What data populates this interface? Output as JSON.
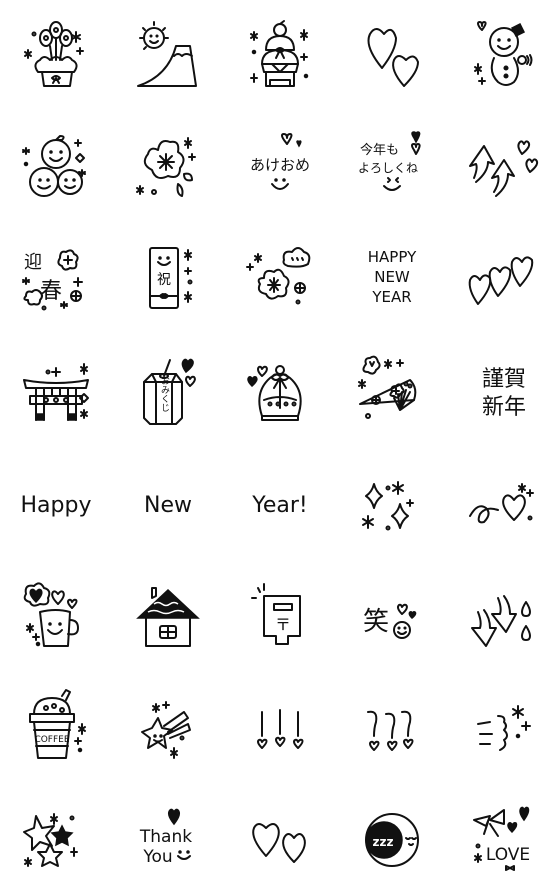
{
  "sticker_set": {
    "layout": {
      "columns": 5,
      "rows": 8
    },
    "stickers": [
      {
        "id": 1,
        "name": "kadomatsu",
        "text": ""
      },
      {
        "id": 2,
        "name": "mount-fuji-sun",
        "text": ""
      },
      {
        "id": 3,
        "name": "kagami-mochi",
        "text": ""
      },
      {
        "id": 4,
        "name": "two-hearts",
        "text": ""
      },
      {
        "id": 5,
        "name": "snowman",
        "text": ""
      },
      {
        "id": 6,
        "name": "mikan-smiles",
        "text": ""
      },
      {
        "id": 7,
        "name": "plum-blossom",
        "text": ""
      },
      {
        "id": 8,
        "name": "akeome",
        "text": "あけおめ"
      },
      {
        "id": 9,
        "name": "kotoshi-mo-yoroshiku",
        "text": "今年も\nよろしくね",
        "line1": "今年も",
        "line2": "よろしくね"
      },
      {
        "id": 10,
        "name": "up-arrows-hearts",
        "text": ""
      },
      {
        "id": 11,
        "name": "geishun",
        "text": "迎春",
        "char1": "迎",
        "char2": "春"
      },
      {
        "id": 12,
        "name": "iwai-envelope",
        "text": "祝"
      },
      {
        "id": 13,
        "name": "plum-cloud",
        "text": ""
      },
      {
        "id": 14,
        "name": "happy-new-year-caps",
        "text": "HAPPY NEW YEAR",
        "line1": "HAPPY",
        "line2": "NEW",
        "line3": "YEAR"
      },
      {
        "id": 15,
        "name": "three-hearts",
        "text": ""
      },
      {
        "id": 16,
        "name": "torii-gate",
        "text": ""
      },
      {
        "id": 17,
        "name": "omikuji",
        "text": "おみくじ"
      },
      {
        "id": 18,
        "name": "snow-globe",
        "text": ""
      },
      {
        "id": 19,
        "name": "folding-fan",
        "text": ""
      },
      {
        "id": 20,
        "name": "kinga-shinnen",
        "text": "謹賀新年",
        "line1": "謹賀",
        "line2": "新年"
      },
      {
        "id": 21,
        "name": "happy-word",
        "text": "Happy"
      },
      {
        "id": 22,
        "name": "new-word",
        "text": "New"
      },
      {
        "id": 23,
        "name": "year-word",
        "text": "Year!"
      },
      {
        "id": 24,
        "name": "sparkles",
        "text": ""
      },
      {
        "id": 25,
        "name": "loop-heart",
        "text": ""
      },
      {
        "id": 26,
        "name": "coffee-mug-hearts",
        "text": ""
      },
      {
        "id": 27,
        "name": "house",
        "text": ""
      },
      {
        "id": 28,
        "name": "post-box",
        "text": "〒"
      },
      {
        "id": 29,
        "name": "warai-smile",
        "text": "笑"
      },
      {
        "id": 30,
        "name": "down-arrows-drops",
        "text": ""
      },
      {
        "id": 31,
        "name": "coffee-cup",
        "text": "COFFEE"
      },
      {
        "id": 32,
        "name": "shooting-star",
        "text": ""
      },
      {
        "id": 33,
        "name": "exclamation-hearts",
        "text": "!!!"
      },
      {
        "id": 34,
        "name": "question-hearts",
        "text": "???"
      },
      {
        "id": 35,
        "name": "whoosh-sparkle",
        "text": ""
      },
      {
        "id": 36,
        "name": "stars",
        "text": ""
      },
      {
        "id": 37,
        "name": "thank-you",
        "text": "Thank You",
        "line1": "Thank",
        "line2": "You"
      },
      {
        "id": 38,
        "name": "two-hearts-outline",
        "text": ""
      },
      {
        "id": 39,
        "name": "sleeping-moon",
        "text": "zzz"
      },
      {
        "id": 40,
        "name": "love-ribbon",
        "text": "LOVE"
      }
    ]
  },
  "colors": {
    "ink": "#111111",
    "background": "#ffffff"
  }
}
